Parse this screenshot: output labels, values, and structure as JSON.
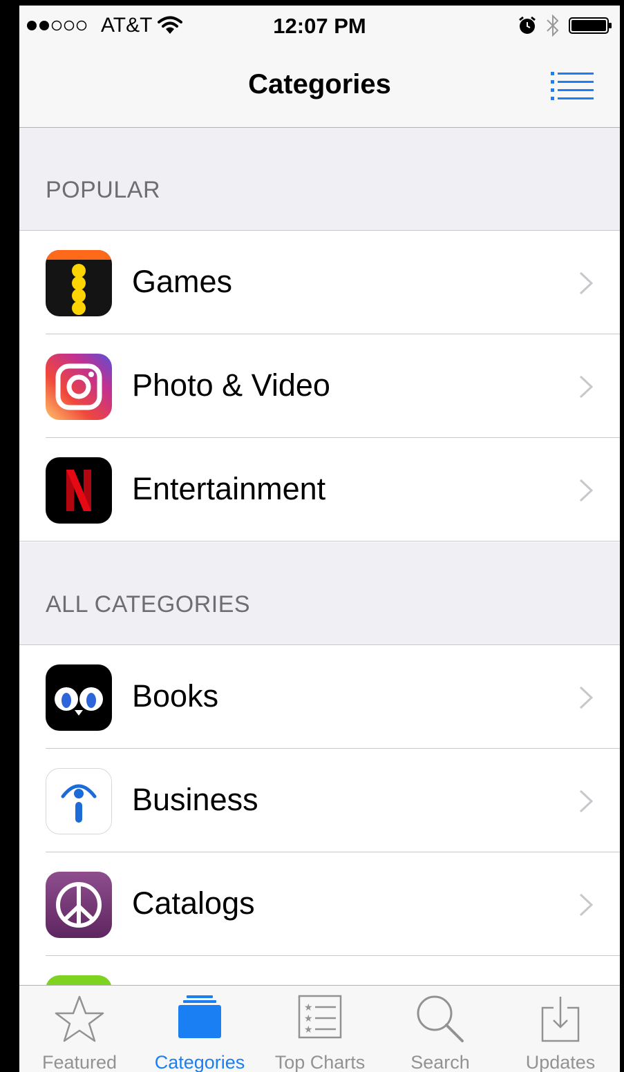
{
  "status_bar": {
    "carrier": "AT&T",
    "time": "12:07 PM"
  },
  "navbar": {
    "title": "Categories",
    "list_button": "list-icon"
  },
  "sections": [
    {
      "header": "POPULAR",
      "rows": [
        {
          "label": "Games",
          "icon": "games-app-icon"
        },
        {
          "label": "Photo & Video",
          "icon": "camera-app-icon"
        },
        {
          "label": "Entertainment",
          "icon": "netflix-app-icon"
        }
      ]
    },
    {
      "header": "ALL CATEGORIES",
      "rows": [
        {
          "label": "Books",
          "icon": "owl-app-icon"
        },
        {
          "label": "Business",
          "icon": "info-app-icon"
        },
        {
          "label": "Catalogs",
          "icon": "peace-app-icon"
        }
      ]
    }
  ],
  "tab_bar": {
    "tabs": [
      {
        "label": "Featured",
        "icon": "star-icon",
        "active": false
      },
      {
        "label": "Categories",
        "icon": "categories-icon",
        "active": true
      },
      {
        "label": "Top Charts",
        "icon": "top-charts-icon",
        "active": false
      },
      {
        "label": "Search",
        "icon": "search-icon",
        "active": false
      },
      {
        "label": "Updates",
        "icon": "updates-icon",
        "active": false
      }
    ]
  },
  "colors": {
    "accent": "#1a7ff2",
    "section_bg": "#efeff4",
    "section_text": "#6d6d72"
  }
}
